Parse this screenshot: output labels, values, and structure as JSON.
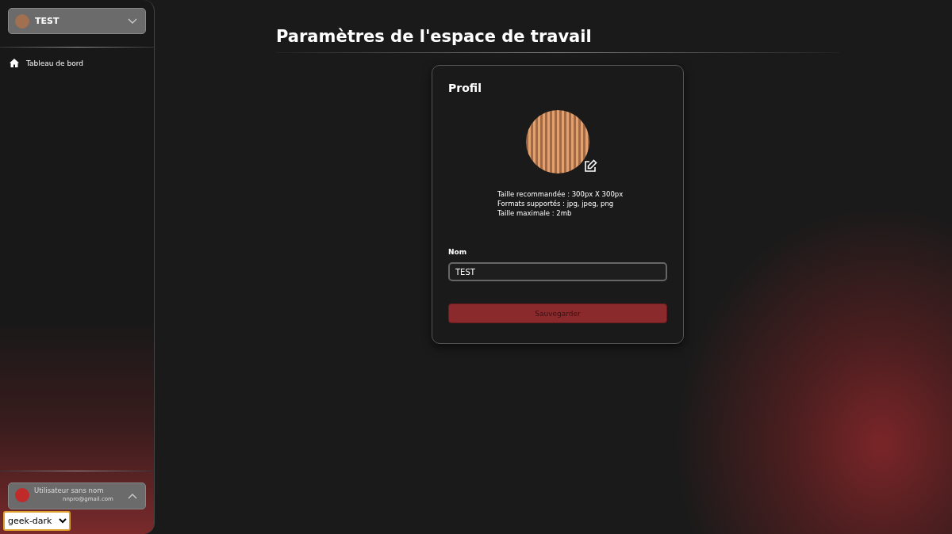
{
  "workspace_switcher": {
    "name": "TEST"
  },
  "sidebar": {
    "items": [
      {
        "label": "Tableau de bord"
      }
    ]
  },
  "user_card": {
    "name": "Utilisateur sans nom",
    "email": "nnpro@gmail.com"
  },
  "theme_select": {
    "value": "geek-dark"
  },
  "page": {
    "title": "Paramètres de l'espace de travail"
  },
  "profile": {
    "heading": "Profil",
    "hints": [
      "Taille recommandée : 300px X 300px",
      "Formats supportés : jpg, jpeg, png",
      "Taille maximale : 2mb"
    ],
    "name_label": "Nom",
    "name_value": "TEST",
    "save_label": "Sauvegarder"
  }
}
